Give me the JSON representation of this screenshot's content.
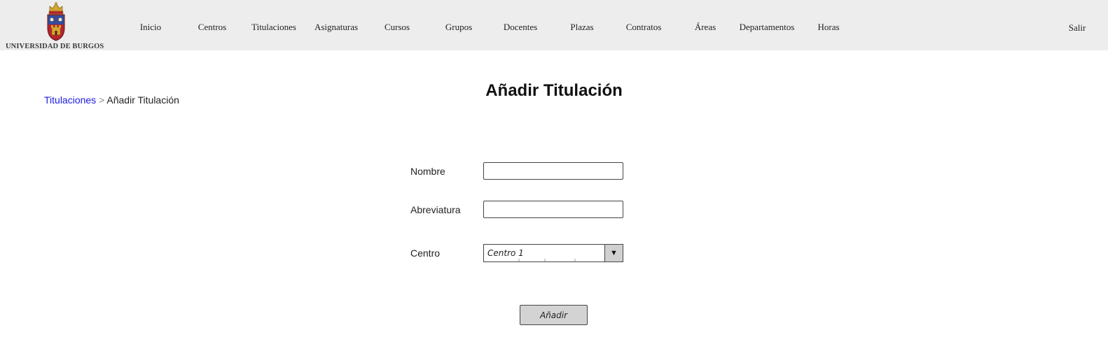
{
  "header": {
    "logo_text": "UNIVERSIDAD DE BURGOS",
    "nav": [
      "Inicio",
      "Centros",
      "Titulaciones",
      "Asignaturas",
      "Cursos",
      "Grupos",
      "Docentes",
      "Plazas",
      "Contratos",
      "Áreas",
      "Departamentos",
      "Horas"
    ],
    "logout_label": "Salir"
  },
  "breadcrumb": {
    "parent": "Titulaciones",
    "separator": ">",
    "current": "Añadir Titulación"
  },
  "page": {
    "title": "Añadir Titulación"
  },
  "form": {
    "name_label": "Nombre",
    "name_value": "",
    "abbr_label": "Abreviatura",
    "abbr_value": "",
    "center_label": "Centro",
    "center_selected": "Centro 1",
    "submit_label": "Añadir"
  },
  "icons": {
    "logo": "university-coat-of-arms-icon",
    "dropdown": "triangle-down-icon"
  },
  "colors": {
    "header_bg": "#ededed",
    "link": "#1a1ae0",
    "button_bg": "#d3d3d3",
    "coat_red": "#b8232e",
    "coat_gold": "#d4a531",
    "coat_blue": "#2a4fa0"
  }
}
